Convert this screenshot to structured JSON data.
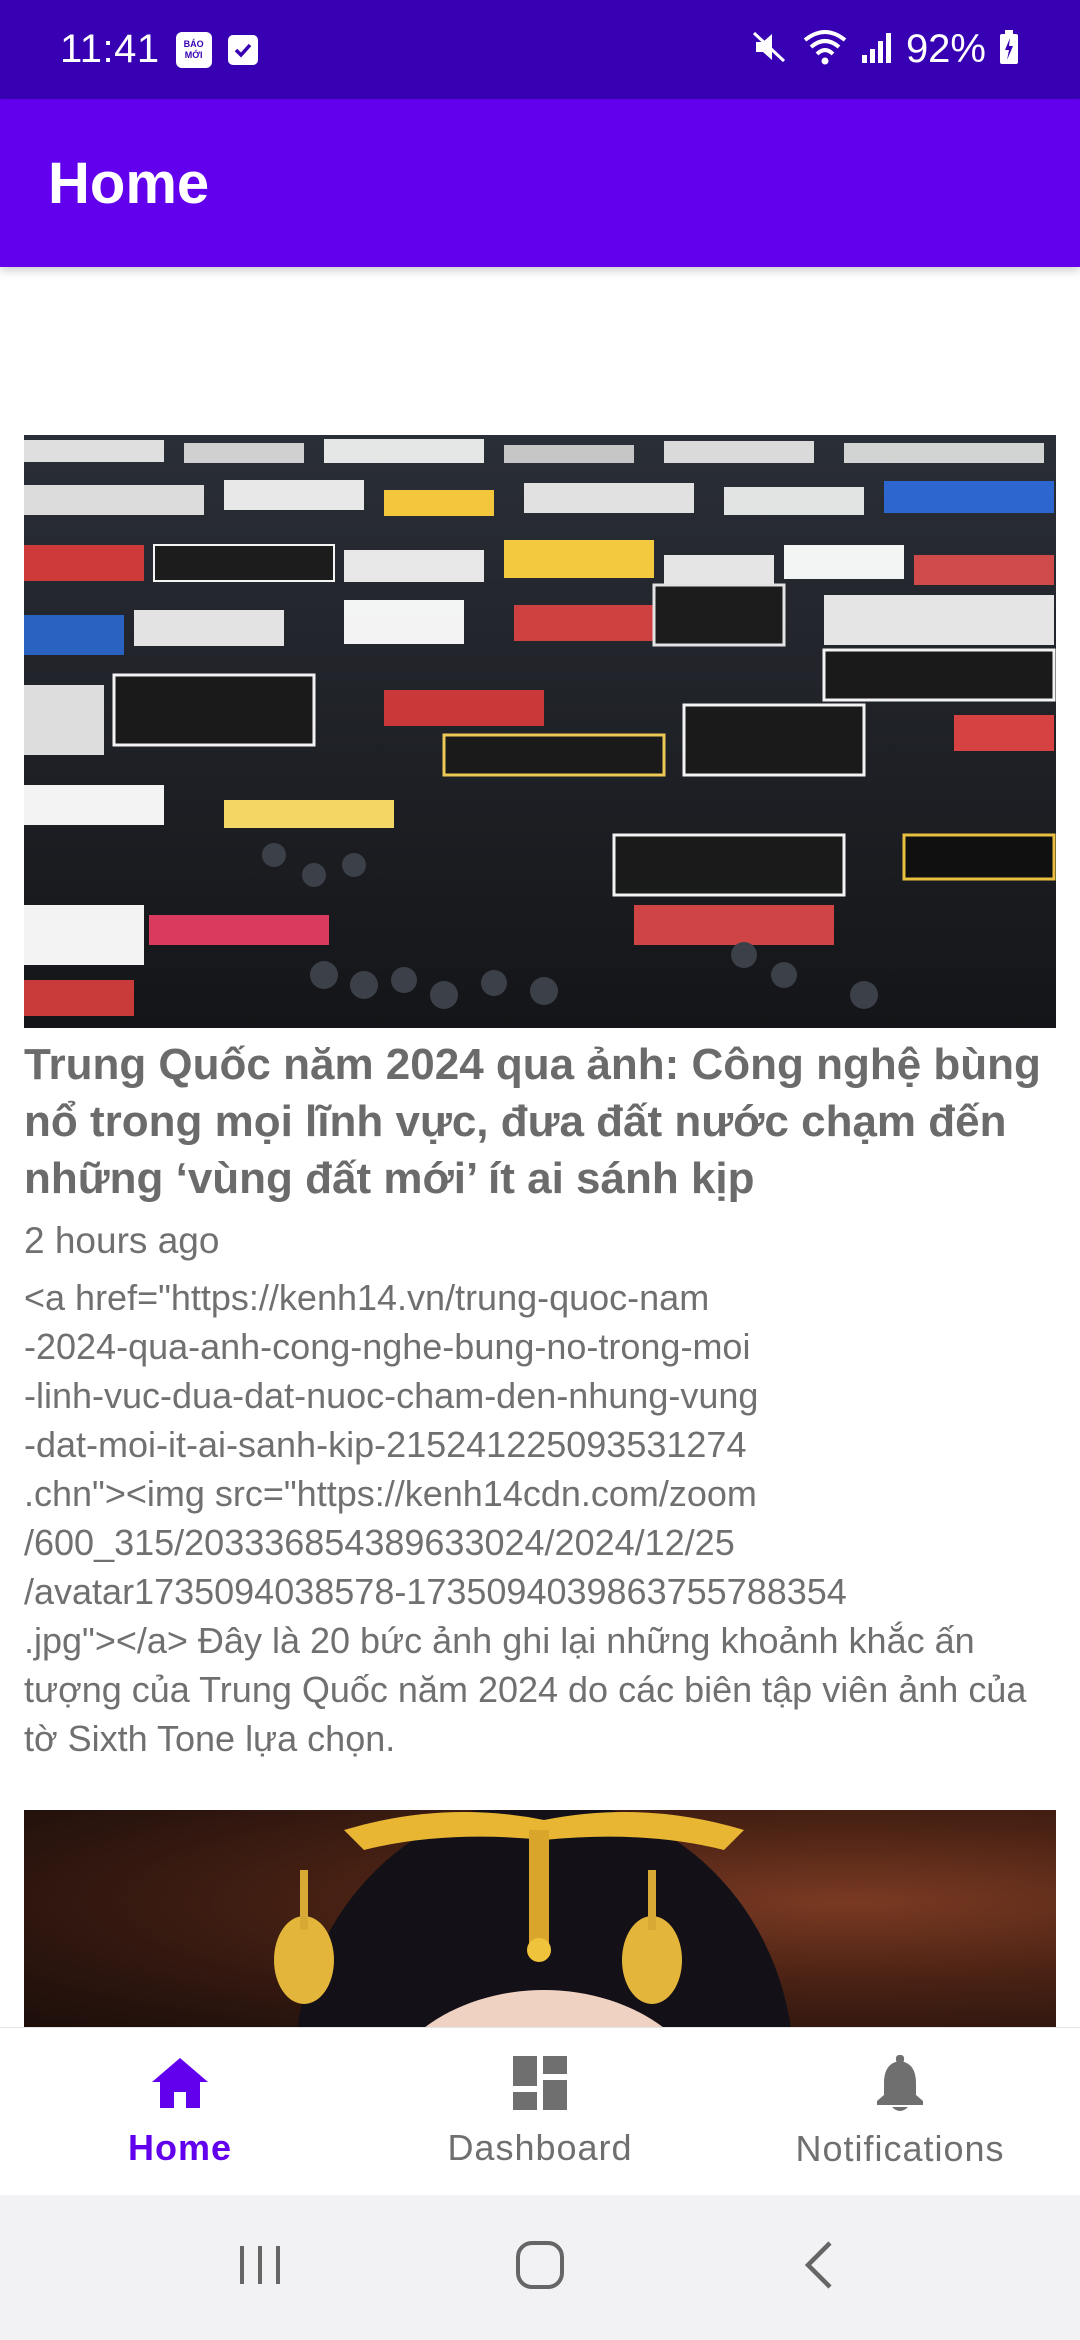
{
  "status_bar": {
    "time": "11:41",
    "notif_badge": "BÁO MỚI",
    "battery": "92%"
  },
  "app_bar": {
    "title": "Home"
  },
  "articles": [
    {
      "title": "Trung Quốc năm 2024 qua ảnh: Công nghệ bùng nổ trong mọi lĩnh vực, đưa đất nước chạm đến những ‘vùng đất mới’ ít ai sánh kịp",
      "time": "2 hours ago",
      "description": "<a href=\"https://kenh14.vn/trung-quoc-nam\n-2024-qua-anh-cong-nghe-bung-no-trong-moi\n-linh-vuc-dua-dat-nuoc-cham-den-nhung-vung\n-dat-moi-it-ai-sanh-kip-215241225093531274\n.chn\"><img src=\"https://kenh14cdn.com/zoom\n/600_315/203336854389633024/2024/12/25\n/avatar1735094038578-1735094039863755788354\n.jpg\"></a> Đây là 20 bức ảnh ghi lại những khoảnh khắc ấn tượng của Trung Quốc năm 2024 do các biên tập viên ảnh của tờ Sixth Tone lựa chọn."
    }
  ],
  "bottom_nav": {
    "items": [
      {
        "label": "Home",
        "icon": "home-icon",
        "active": true
      },
      {
        "label": "Dashboard",
        "icon": "dashboard-icon",
        "active": false
      },
      {
        "label": "Notifications",
        "icon": "bell-icon",
        "active": false
      }
    ]
  },
  "colors": {
    "status_bar": "#3700B3",
    "app_bar": "#6200EE",
    "accent": "#6200EE"
  }
}
